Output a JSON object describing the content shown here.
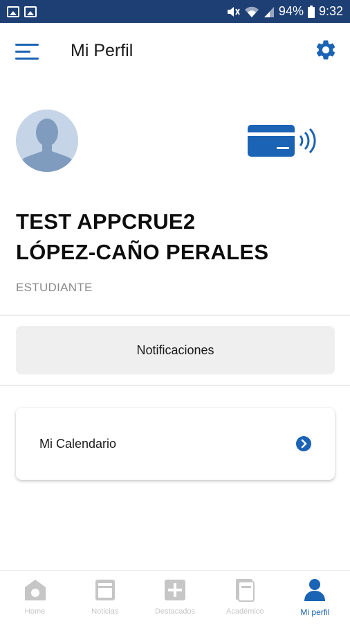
{
  "status_bar": {
    "battery": "94%",
    "time": "9:32"
  },
  "app_bar": {
    "title": "Mi Perfil"
  },
  "profile": {
    "name_line1": "TEST APPCRUE2",
    "name_line2": "LÓPEZ-CAÑO PERALES",
    "role": "ESTUDIANTE"
  },
  "actions": {
    "notifications_label": "Notificaciones",
    "calendar_label": "Mi Calendario"
  },
  "bottom_nav": {
    "items": [
      {
        "label": "Home",
        "icon": "home-icon"
      },
      {
        "label": "Noticias",
        "icon": "news-icon"
      },
      {
        "label": "Destacados",
        "icon": "plus-icon"
      },
      {
        "label": "Académico",
        "icon": "book-icon"
      },
      {
        "label": "Mi perfil",
        "icon": "person-icon"
      }
    ],
    "active_index": 4
  },
  "colors": {
    "accent": "#1a63b5",
    "status_bar": "#1d3f73",
    "inactive": "#c6c6c6"
  }
}
